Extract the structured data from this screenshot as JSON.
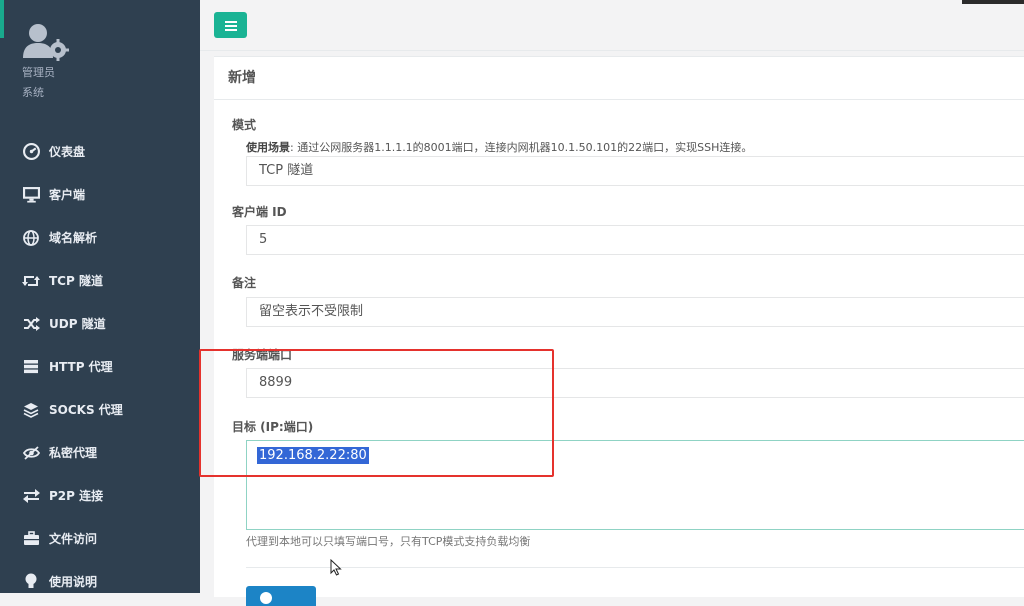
{
  "sidebar": {
    "profile": {
      "name": "管理员",
      "role": "系统"
    },
    "items": [
      {
        "label": "仪表盘",
        "icon": "dashboard-icon"
      },
      {
        "label": "客户端",
        "icon": "monitor-icon"
      },
      {
        "label": "域名解析",
        "icon": "globe-icon"
      },
      {
        "label": "TCP 隧道",
        "icon": "retweet-icon"
      },
      {
        "label": "UDP 隧道",
        "icon": "shuffle-icon"
      },
      {
        "label": "HTTP 代理",
        "icon": "server-icon"
      },
      {
        "label": "SOCKS 代理",
        "icon": "layers-icon"
      },
      {
        "label": "私密代理",
        "icon": "eye-slash-icon"
      },
      {
        "label": "P2P 连接",
        "icon": "exchange-icon"
      },
      {
        "label": "文件访问",
        "icon": "briefcase-icon"
      },
      {
        "label": "使用说明",
        "icon": "lightbulb-icon"
      }
    ]
  },
  "panel": {
    "title": "新增",
    "mode": {
      "label": "模式",
      "help_prefix": "使用场景",
      "help_text": ": 通过公网服务器1.1.1.1的8001端口，连接内网机器10.1.50.101的22端口，实现SSH连接。",
      "value": "TCP 隧道"
    },
    "client_id": {
      "label": "客户端 ID",
      "value": "5"
    },
    "remark": {
      "label": "备注",
      "placeholder": "留空表示不受限制"
    },
    "server_port": {
      "label": "服务端端口",
      "value": "8899"
    },
    "target": {
      "label": "目标 (IP:端口)",
      "value": "192.168.2.22:80",
      "note": "代理到本地可以只填写端口号，只有TCP模式支持负载均衡"
    }
  },
  "colors": {
    "sidebar_bg": "#2f4050",
    "accent": "#1ab394",
    "highlight": "#e5322d",
    "primary": "#1c84c6"
  }
}
